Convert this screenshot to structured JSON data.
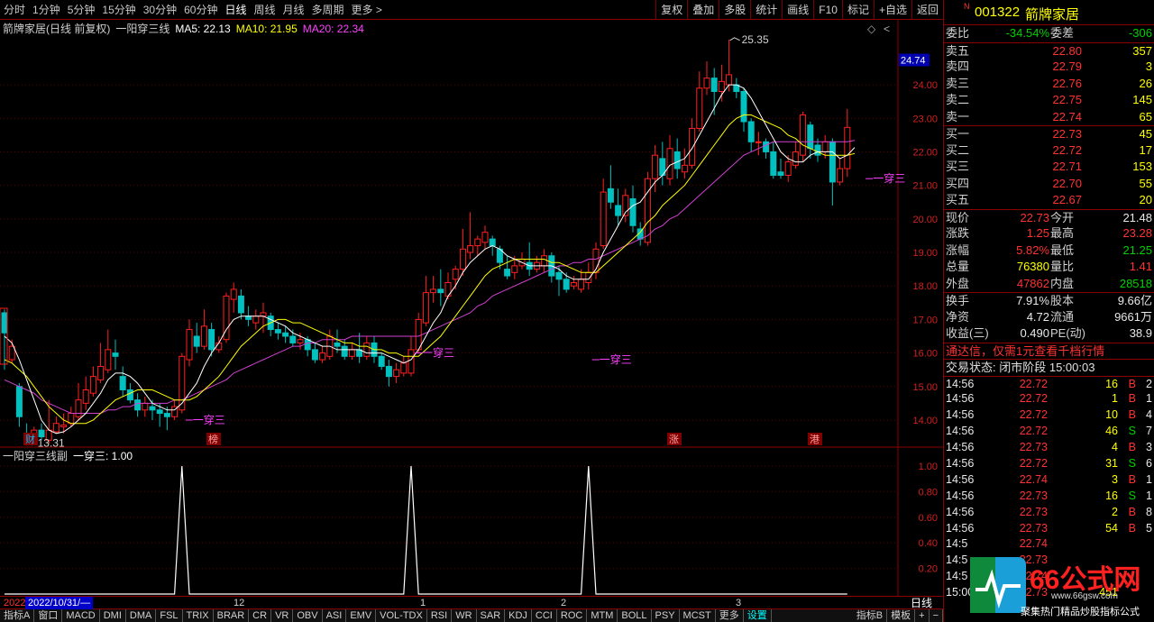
{
  "toolbar": {
    "periods": [
      "分时",
      "1分钟",
      "5分钟",
      "15分钟",
      "30分钟",
      "60分钟",
      "日线",
      "周线",
      "月线",
      "多周期",
      "更多 >"
    ],
    "active_period": "日线",
    "right_buttons": [
      "复权",
      "叠加",
      "多股",
      "统计",
      "画线",
      "F10",
      "标记",
      "+自选",
      "返回"
    ]
  },
  "chart_header": {
    "title": "箭牌家居(日线 前复权)",
    "indicator": "一阳穿三线",
    "ma5": "MA5: 22.13",
    "ma10": "MA10: 21.95",
    "ma20": "MA20: 22.34",
    "diamond": "◇",
    "arrow": "<"
  },
  "sub_header": {
    "name": "一阳穿三线副",
    "value": "一穿三: 1.00"
  },
  "axis": {
    "main_ticks": [
      "24.00",
      "23.00",
      "22.00",
      "21.00",
      "20.00",
      "19.00",
      "18.00",
      "17.00",
      "16.00",
      "15.00",
      "14.00"
    ],
    "current_price_label": "24.74",
    "sub_ticks": [
      "1.00",
      "0.80",
      "0.60",
      "0.40",
      "0.20"
    ]
  },
  "annotations": {
    "high": "25.35",
    "low": "13.31",
    "signal": "一穿三",
    "markers": [
      "财",
      "榜",
      "涨",
      "港"
    ]
  },
  "chart_data": {
    "type": "candlestick",
    "ylim": [
      13.3,
      25.4
    ],
    "candles": [
      [
        17.2,
        16.6,
        17.3,
        15.5
      ],
      [
        15.8,
        16.2,
        16.4,
        15.7
      ],
      [
        15.0,
        14.1,
        15.1,
        13.8
      ],
      [
        13.6,
        13.4,
        13.9,
        13.31
      ],
      [
        13.45,
        13.7,
        13.8,
        13.4
      ],
      [
        13.7,
        13.5,
        13.9,
        13.4
      ],
      [
        13.4,
        13.7,
        14.6,
        13.3
      ],
      [
        13.65,
        13.9,
        14.1,
        13.6
      ],
      [
        13.8,
        13.85,
        14.2,
        13.6
      ],
      [
        13.9,
        14.2,
        14.4,
        13.8
      ],
      [
        14.1,
        14.6,
        15.1,
        14.0
      ],
      [
        14.5,
        14.9,
        15.3,
        14.3
      ],
      [
        14.8,
        15.3,
        15.6,
        14.7
      ],
      [
        15.2,
        15.6,
        16.3,
        15.1
      ],
      [
        15.5,
        16.1,
        16.7,
        15.4
      ],
      [
        16.0,
        15.9,
        16.4,
        15.5
      ],
      [
        15.3,
        14.9,
        15.6,
        14.7
      ],
      [
        14.9,
        14.6,
        15.1,
        14.5
      ],
      [
        14.6,
        14.3,
        14.8,
        14.1
      ],
      [
        14.3,
        14.5,
        14.7,
        14.1
      ],
      [
        14.4,
        14.3,
        14.6,
        14.0
      ],
      [
        14.3,
        14.2,
        14.5,
        13.8
      ],
      [
        14.2,
        14.1,
        14.4,
        13.7
      ],
      [
        14.1,
        14.4,
        14.6,
        14.0
      ],
      [
        14.3,
        15.9,
        16.0,
        14.2
      ],
      [
        15.8,
        16.7,
        17.0,
        15.6
      ],
      [
        16.5,
        16.2,
        16.9,
        16.0
      ],
      [
        16.2,
        16.8,
        17.3,
        16.1
      ],
      [
        16.7,
        16.1,
        16.9,
        15.9
      ],
      [
        16.1,
        16.3,
        16.5,
        16.0
      ],
      [
        16.4,
        17.7,
        17.8,
        16.3
      ],
      [
        17.6,
        17.9,
        18.1,
        17.2
      ],
      [
        17.7,
        17.2,
        17.9,
        17.0
      ],
      [
        17.1,
        17.0,
        17.4,
        16.8
      ],
      [
        16.9,
        17.1,
        17.3,
        16.7
      ],
      [
        17.1,
        17.2,
        17.5,
        16.6
      ],
      [
        17.1,
        16.7,
        17.2,
        16.5
      ],
      [
        16.7,
        16.6,
        16.9,
        16.4
      ],
      [
        16.6,
        16.5,
        16.8,
        16.3
      ],
      [
        16.5,
        16.3,
        16.7,
        16.2
      ],
      [
        16.3,
        16.4,
        16.6,
        16.1
      ],
      [
        16.4,
        16.1,
        16.5,
        15.9
      ],
      [
        16.1,
        15.8,
        16.3,
        15.7
      ],
      [
        15.8,
        16.0,
        16.2,
        15.7
      ],
      [
        15.9,
        16.5,
        16.7,
        15.8
      ],
      [
        16.3,
        16.2,
        16.7,
        16.0
      ],
      [
        16.2,
        15.9,
        16.4,
        15.8
      ],
      [
        15.9,
        16.1,
        16.3,
        15.8
      ],
      [
        16.1,
        15.9,
        16.6,
        15.7
      ],
      [
        15.9,
        16.3,
        16.5,
        15.8
      ],
      [
        16.3,
        15.9,
        16.5,
        15.7
      ],
      [
        15.9,
        15.6,
        16.0,
        15.5
      ],
      [
        15.6,
        15.3,
        15.8,
        15.0
      ],
      [
        15.3,
        15.5,
        15.7,
        15.1
      ],
      [
        15.4,
        15.7,
        15.9,
        15.3
      ],
      [
        15.4,
        16.1,
        16.5,
        15.3
      ],
      [
        16.1,
        17.0,
        17.2,
        16.0
      ],
      [
        16.9,
        17.8,
        18.3,
        16.8
      ],
      [
        17.8,
        17.9,
        18.3,
        17.5
      ],
      [
        17.9,
        17.8,
        18.5,
        17.4
      ],
      [
        17.7,
        18.1,
        18.4,
        17.6
      ],
      [
        18.2,
        18.5,
        18.6,
        17.9
      ],
      [
        18.5,
        19.1,
        19.7,
        18.3
      ],
      [
        19.0,
        19.2,
        20.2,
        18.8
      ],
      [
        19.2,
        19.4,
        19.5,
        18.9
      ],
      [
        19.3,
        19.6,
        19.8,
        19.1
      ],
      [
        19.4,
        19.2,
        19.5,
        18.9
      ],
      [
        19.1,
        18.7,
        19.2,
        18.5
      ],
      [
        18.5,
        18.3,
        18.9,
        18.2
      ],
      [
        18.4,
        18.6,
        18.9,
        18.2
      ],
      [
        18.6,
        18.8,
        19.0,
        18.5
      ],
      [
        18.7,
        18.5,
        19.3,
        18.3
      ],
      [
        18.5,
        18.7,
        18.9,
        18.4
      ],
      [
        18.6,
        18.9,
        19.1,
        18.4
      ],
      [
        18.9,
        18.3,
        19.0,
        18.1
      ],
      [
        18.4,
        18.2,
        18.6,
        17.7
      ],
      [
        18.2,
        17.9,
        18.4,
        17.8
      ],
      [
        18.0,
        18.1,
        18.3,
        17.9
      ],
      [
        17.9,
        18.2,
        18.5,
        17.8
      ],
      [
        18.1,
        18.4,
        18.7,
        17.9
      ],
      [
        18.4,
        19.1,
        19.3,
        18.2
      ],
      [
        19.2,
        20.8,
        21.2,
        19.1
      ],
      [
        20.9,
        20.5,
        21.6,
        20.3
      ],
      [
        20.4,
        20.1,
        20.9,
        19.8
      ],
      [
        20.1,
        20.7,
        20.9,
        19.9
      ],
      [
        20.6,
        19.8,
        21.0,
        19.6
      ],
      [
        19.7,
        19.4,
        19.9,
        19.2
      ],
      [
        19.3,
        21.2,
        21.4,
        19.2
      ],
      [
        21.2,
        21.9,
        22.2,
        20.8
      ],
      [
        21.8,
        21.3,
        22.3,
        21.0
      ],
      [
        21.2,
        22.1,
        22.5,
        21.0
      ],
      [
        22.0,
        21.5,
        22.4,
        21.2
      ],
      [
        21.4,
        21.6,
        22.1,
        21.2
      ],
      [
        21.6,
        22.7,
        23.0,
        21.5
      ],
      [
        22.7,
        23.9,
        24.4,
        22.6
      ],
      [
        23.9,
        24.2,
        24.7,
        23.7
      ],
      [
        24.2,
        23.8,
        24.5,
        23.1
      ],
      [
        23.8,
        24.1,
        24.6,
        23.5
      ],
      [
        24.0,
        24.3,
        25.35,
        23.8
      ],
      [
        24.0,
        23.8,
        24.2,
        23.6
      ],
      [
        23.8,
        22.9,
        23.9,
        22.6
      ],
      [
        22.9,
        22.3,
        23.0,
        22.0
      ],
      [
        22.3,
        22.3,
        22.6,
        21.9
      ],
      [
        22.3,
        22.0,
        22.4,
        21.8
      ],
      [
        22.0,
        21.3,
        22.3,
        21.2
      ],
      [
        21.4,
        21.3,
        21.8,
        21.2
      ],
      [
        21.3,
        21.7,
        21.9,
        21.1
      ],
      [
        21.6,
        22.0,
        22.3,
        21.5
      ],
      [
        21.9,
        23.1,
        23.2,
        21.7
      ],
      [
        22.8,
        22.1,
        22.9,
        21.8
      ],
      [
        22.2,
        21.9,
        22.4,
        21.7
      ],
      [
        22.0,
        22.3,
        22.5,
        21.8
      ],
      [
        22.3,
        21.1,
        22.4,
        20.4
      ],
      [
        21.1,
        21.5,
        21.8,
        21.0
      ],
      [
        21.5,
        22.73,
        23.28,
        21.25
      ]
    ],
    "ma5": [
      16.5,
      16.3,
      15.8,
      15.2,
      14.6,
      14.0,
      13.7,
      13.6,
      13.65,
      13.8,
      14.0,
      14.2,
      14.5,
      14.8,
      15.2,
      15.4,
      15.4,
      15.3,
      15.1,
      14.8,
      14.5,
      14.4,
      14.3,
      14.3,
      14.5,
      14.8,
      15.1,
      15.6,
      16.0,
      16.3,
      16.7,
      17.0,
      17.1,
      17.1,
      17.1,
      17.1,
      17.0,
      16.9,
      16.8,
      16.6,
      16.5,
      16.4,
      16.3,
      16.2,
      16.2,
      16.1,
      16.1,
      16.1,
      16.1,
      16.0,
      16.0,
      16.0,
      15.9,
      15.8,
      15.7,
      15.8,
      16.1,
      16.5,
      16.9,
      17.2,
      17.7,
      18.0,
      18.4,
      18.7,
      18.9,
      19.1,
      19.2,
      19.1,
      18.9,
      18.8,
      18.7,
      18.6,
      18.6,
      18.6,
      18.6,
      18.5,
      18.3,
      18.2,
      18.2,
      18.2,
      18.5,
      19.0,
      19.4,
      19.8,
      20.2,
      20.4,
      20.5,
      20.8,
      21.1,
      21.3,
      21.6,
      21.7,
      21.8,
      22.1,
      22.5,
      22.9,
      23.3,
      23.7,
      24.0,
      24.0,
      23.9,
      23.6,
      23.2,
      22.8,
      22.4,
      22.0,
      21.8,
      21.7,
      21.7,
      21.9,
      22.0,
      22.0,
      22.0,
      21.8,
      21.9,
      22.13
    ],
    "ma10": [
      15.8,
      15.7,
      15.5,
      15.3,
      15.0,
      14.7,
      14.4,
      14.2,
      14.0,
      13.9,
      13.9,
      13.9,
      14.0,
      14.2,
      14.4,
      14.6,
      14.7,
      14.8,
      14.9,
      14.9,
      14.9,
      14.8,
      14.7,
      14.6,
      14.6,
      14.6,
      14.7,
      14.9,
      15.1,
      15.3,
      15.6,
      15.9,
      16.2,
      16.4,
      16.6,
      16.8,
      16.9,
      17.0,
      17.0,
      16.9,
      16.9,
      16.8,
      16.7,
      16.6,
      16.5,
      16.4,
      16.3,
      16.3,
      16.2,
      16.2,
      16.1,
      16.1,
      16.0,
      16.0,
      15.9,
      15.9,
      15.9,
      16.1,
      16.3,
      16.5,
      16.8,
      17.1,
      17.4,
      17.7,
      18.0,
      18.3,
      18.5,
      18.6,
      18.7,
      18.8,
      18.8,
      18.8,
      18.8,
      18.8,
      18.7,
      18.7,
      18.6,
      18.5,
      18.4,
      18.4,
      18.4,
      18.6,
      18.8,
      19.0,
      19.2,
      19.4,
      19.6,
      19.9,
      20.1,
      20.4,
      20.6,
      20.8,
      21.0,
      21.3,
      21.6,
      21.9,
      22.2,
      22.5,
      22.8,
      23.0,
      23.1,
      23.1,
      23.0,
      22.9,
      22.8,
      22.7,
      22.5,
      22.4,
      22.2,
      22.1,
      22.0,
      21.9,
      21.9,
      21.9,
      21.9,
      21.95
    ],
    "ma20": [
      15.2,
      15.1,
      15.0,
      14.9,
      14.8,
      14.6,
      14.5,
      14.4,
      14.3,
      14.2,
      14.2,
      14.2,
      14.2,
      14.2,
      14.3,
      14.3,
      14.4,
      14.4,
      14.5,
      14.5,
      14.5,
      14.5,
      14.5,
      14.6,
      14.6,
      14.7,
      14.8,
      14.9,
      15.0,
      15.1,
      15.2,
      15.4,
      15.5,
      15.6,
      15.7,
      15.8,
      15.9,
      16.0,
      16.1,
      16.2,
      16.2,
      16.3,
      16.3,
      16.4,
      16.4,
      16.4,
      16.4,
      16.5,
      16.5,
      16.5,
      16.5,
      16.5,
      16.5,
      16.5,
      16.5,
      16.5,
      16.5,
      16.6,
      16.7,
      16.8,
      16.9,
      17.0,
      17.1,
      17.2,
      17.4,
      17.5,
      17.7,
      17.8,
      17.9,
      18.0,
      18.1,
      18.2,
      18.3,
      18.4,
      18.5,
      18.6,
      18.6,
      18.7,
      18.7,
      18.8,
      18.8,
      18.9,
      19.0,
      19.1,
      19.2,
      19.3,
      19.4,
      19.5,
      19.7,
      19.8,
      20.0,
      20.1,
      20.3,
      20.5,
      20.7,
      20.9,
      21.1,
      21.3,
      21.5,
      21.7,
      21.9,
      22.0,
      22.1,
      22.2,
      22.3,
      22.3,
      22.3,
      22.3,
      22.3,
      22.3,
      22.3,
      22.3,
      22.3,
      22.3,
      22.3,
      22.34
    ],
    "signals": [
      24,
      55,
      79,
      116
    ]
  },
  "sub_data": {
    "signal_values": "一穿三 = 1.00 on signal days, else 0"
  },
  "nav": {
    "year_prefix": "2022",
    "date_box": "2022/10/31/—",
    "ticks": [
      "12",
      "1",
      "2",
      "3"
    ],
    "label": "日线"
  },
  "tabs": [
    "指标A",
    "窗口",
    "MACD",
    "DMI",
    "DMA",
    "FSL",
    "TRIX",
    "BRAR",
    "CR",
    "VR",
    "OBV",
    "ASI",
    "EMV",
    "VOL-TDX",
    "RSI",
    "WR",
    "SAR",
    "KDJ",
    "CCI",
    "ROC",
    "MTM",
    "BOLL",
    "PSY",
    "MCST",
    "更多",
    "设置"
  ],
  "tabs_right": [
    "指标B",
    "模板",
    "+",
    "−"
  ],
  "panel": {
    "badge": "N",
    "code": "001322",
    "name": "箭牌家居",
    "weibi": {
      "label": "委比",
      "pct": "-34.54%",
      "label2": "委差",
      "val": "-306"
    },
    "asks": [
      [
        "卖五",
        "22.80",
        "357"
      ],
      [
        "卖四",
        "22.79",
        "3"
      ],
      [
        "卖三",
        "22.76",
        "26"
      ],
      [
        "卖二",
        "22.75",
        "145"
      ],
      [
        "卖一",
        "22.74",
        "65"
      ]
    ],
    "bids": [
      [
        "买一",
        "22.73",
        "45"
      ],
      [
        "买二",
        "22.72",
        "17"
      ],
      [
        "买三",
        "22.71",
        "153"
      ],
      [
        "买四",
        "22.70",
        "55"
      ],
      [
        "买五",
        "22.67",
        "20"
      ]
    ],
    "stats": [
      [
        "现价",
        "22.73",
        "今开",
        "21.48"
      ],
      [
        "涨跌",
        "1.25",
        "最高",
        "23.28"
      ],
      [
        "涨幅",
        "5.82%",
        "最低",
        "21.25"
      ],
      [
        "总量",
        "76380",
        "量比",
        "1.41"
      ],
      [
        "外盘",
        "47862",
        "内盘",
        "28518"
      ]
    ],
    "stats2": [
      [
        "换手",
        "7.91%",
        "股本",
        "9.66亿"
      ],
      [
        "净资",
        "4.72",
        "流通",
        "9661万"
      ],
      [
        "收益(三)",
        "0.490",
        "PE(动)",
        "38.9"
      ]
    ],
    "ad": "通达信，仅需1元查看千档行情",
    "status": "交易状态: 闭市阶段 15:00:03",
    "ticks": [
      [
        "14:56",
        "22.72",
        "16",
        "B",
        "2"
      ],
      [
        "14:56",
        "22.72",
        "1",
        "B",
        "1"
      ],
      [
        "14:56",
        "22.72",
        "10",
        "B",
        "4"
      ],
      [
        "14:56",
        "22.72",
        "46",
        "S",
        "7"
      ],
      [
        "14:56",
        "22.73",
        "4",
        "B",
        "3"
      ],
      [
        "14:56",
        "22.72",
        "31",
        "S",
        "6"
      ],
      [
        "14:56",
        "22.74",
        "3",
        "B",
        "1"
      ],
      [
        "14:56",
        "22.73",
        "16",
        "S",
        "1"
      ],
      [
        "14:56",
        "22.73",
        "2",
        "B",
        "8"
      ],
      [
        "14:56",
        "22.73",
        "54",
        "B",
        "5"
      ],
      [
        "14:5",
        "22.74",
        "",
        "",
        ""
      ],
      [
        "14:5",
        "22.73",
        "",
        "",
        ""
      ],
      [
        "14:5",
        "22.74",
        "",
        "",
        ""
      ],
      [
        "15:00",
        "22.73",
        "451",
        "",
        ""
      ]
    ]
  },
  "watermark": {
    "brand": "66公式网",
    "url": "www.66gsw.com",
    "slogan": "聚集热门精品炒股指标公式"
  }
}
